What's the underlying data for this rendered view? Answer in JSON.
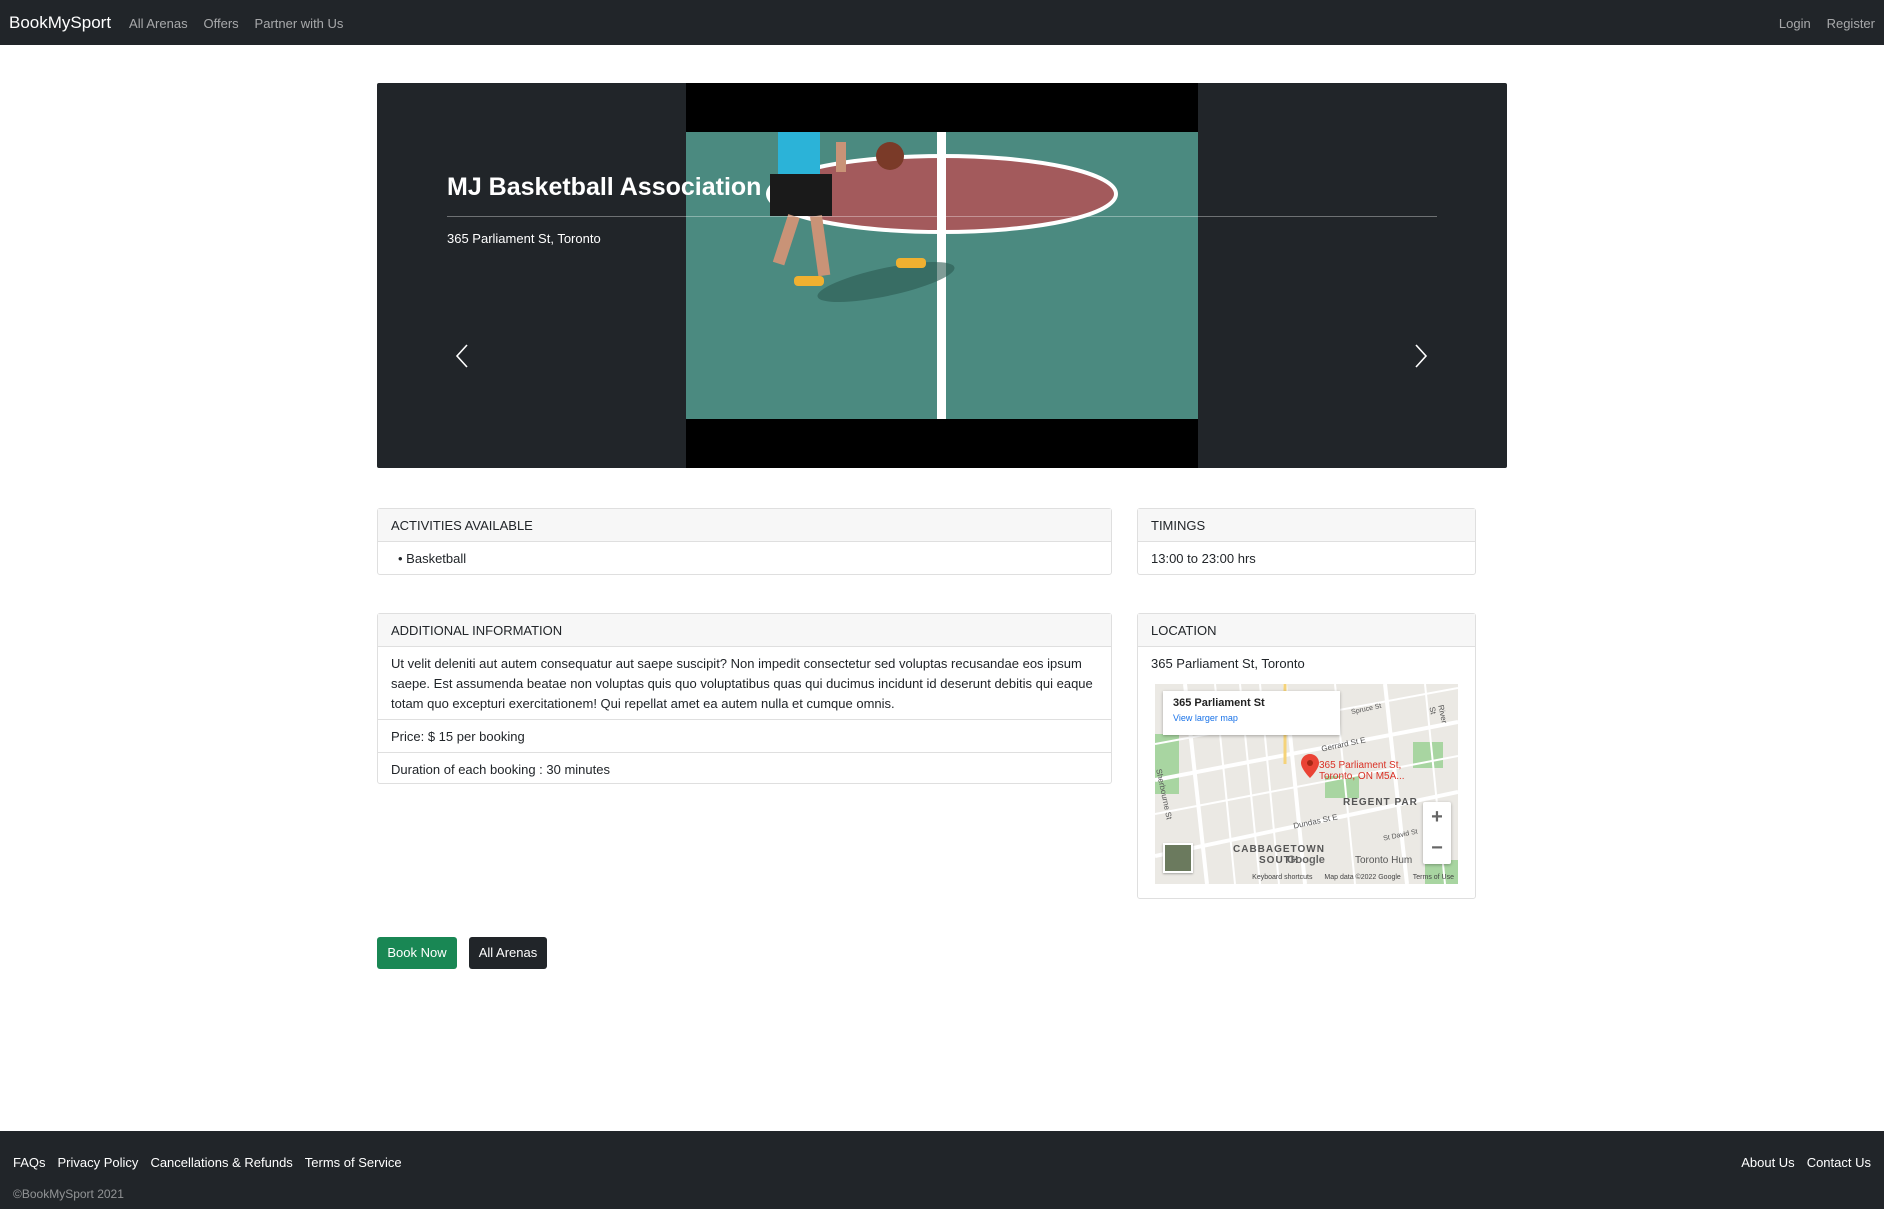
{
  "navbar": {
    "brand": "BookMySport",
    "links": [
      "All Arenas",
      "Offers",
      "Partner with Us"
    ],
    "right_links": [
      "Login",
      "Register"
    ]
  },
  "carousel": {
    "title": "MJ Basketball Association",
    "address": "365 Parliament St, Toronto",
    "prev_icon": "chevron-left-icon",
    "next_icon": "chevron-right-icon"
  },
  "activities": {
    "header": "ACTIVITIES AVAILABLE",
    "items": [
      "Basketball"
    ]
  },
  "timings": {
    "header": "TIMINGS",
    "value": "13:00 to 23:00 hrs"
  },
  "additional_info": {
    "header": "ADDITIONAL INFORMATION",
    "description": "Ut velit deleniti aut autem consequatur aut saepe suscipit? Non impedit consectetur sed voluptas recusandae eos ipsum saepe. Est assumenda beatae non voluptas quis quo voluptatibus quas qui ducimus incidunt id deserunt debitis qui eaque totam quo excepturi exercitationem! Qui repellat amet ea autem nulla et cumque omnis.",
    "price": "Price: $ 15 per booking",
    "duration": "Duration of each booking : 30 minutes"
  },
  "location": {
    "header": "LOCATION",
    "address": "365 Parliament St, Toronto",
    "map": {
      "info_title": "365 Parliament St",
      "info_link": "View larger map",
      "pin_label": "365 Parliament St, Toronto, ON M5A...",
      "area_labels": [
        "REGENT PAR",
        "CABBAGETOWN",
        "SOUTH",
        "Toronto Hum"
      ],
      "street_labels": [
        "Gerrard St E",
        "Dundas St E",
        "Sherbourne St",
        "River St",
        "Spruce St",
        "St David St"
      ],
      "zoom_in": "+",
      "zoom_out": "−",
      "logo": "Google",
      "footer": [
        "Keyboard shortcuts",
        "Map data ©2022 Google",
        "Terms of Use"
      ]
    }
  },
  "buttons": {
    "book_now": "Book Now",
    "all_arenas": "All Arenas"
  },
  "footer": {
    "links": [
      "FAQs",
      "Privacy Policy",
      "Cancellations & Refunds",
      "Terms of Service"
    ],
    "right_links": [
      "About Us",
      "Contact Us"
    ],
    "copyright": "©BookMySport 2021"
  },
  "colors": {
    "navbar_bg": "#212529",
    "book_button": "#198754",
    "court_green": "#4f8f84",
    "court_red": "#a35a5c"
  }
}
